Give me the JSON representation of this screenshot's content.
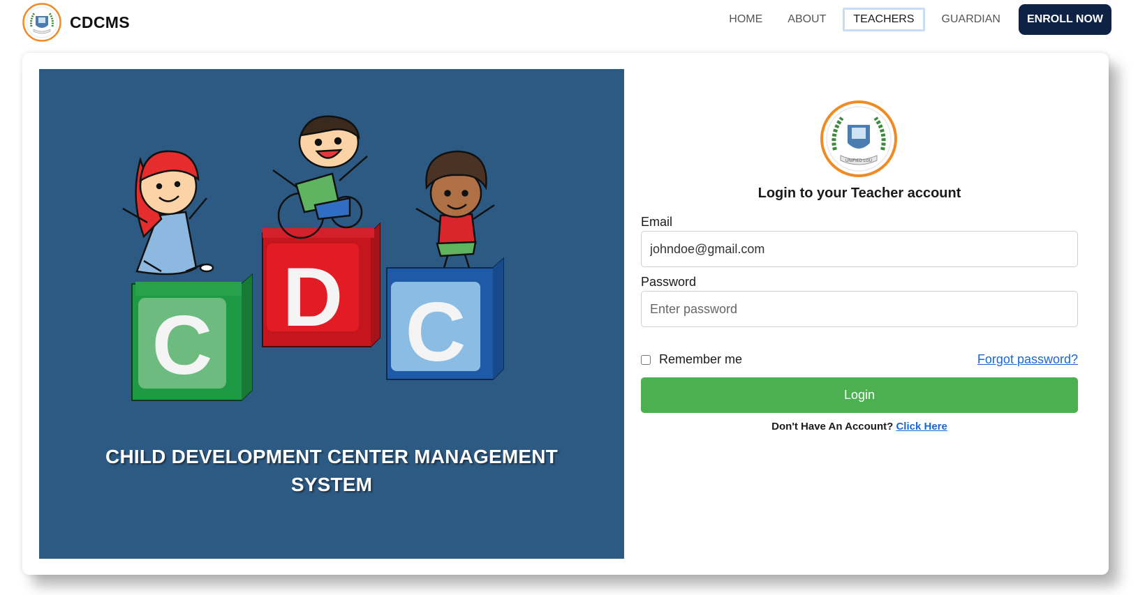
{
  "brand": {
    "name": "CDCMS",
    "logo_icon": "unified-lgu-seal-icon"
  },
  "nav": {
    "links": [
      {
        "label": "HOME",
        "active": false
      },
      {
        "label": "ABOUT",
        "active": false
      },
      {
        "label": "TEACHERS",
        "active": true
      },
      {
        "label": "GUARDIAN",
        "active": false
      }
    ],
    "cta_label": "ENROLL NOW"
  },
  "hero": {
    "title_line1": "CHILD DEVELOPMENT CENTER MANAGEMENT",
    "title_line2": "SYSTEM",
    "blocks": [
      "C",
      "D",
      "C"
    ],
    "background_color": "#2d5a82"
  },
  "login": {
    "logo_icon": "unified-lgu-seal-icon",
    "title": "Login to your Teacher account",
    "email_label": "Email",
    "email_value": "johndoe@gmail.com",
    "password_label": "Password",
    "password_placeholder": "Enter password",
    "remember_label": "Remember me",
    "forgot_label": "Forgot password?",
    "submit_label": "Login",
    "no_account_text": "Don't Have An Account?",
    "signup_link_label": "Click Here",
    "button_color": "#4caf50",
    "link_color": "#1a66d6"
  },
  "colors": {
    "enroll_button": "#0e2245",
    "active_tab_border": "#c6dcf7"
  }
}
